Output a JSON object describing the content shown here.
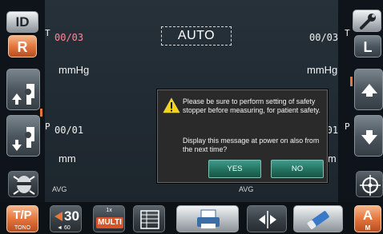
{
  "left_panel": {
    "id_label": "ID",
    "r_label": "R",
    "tono_main": "T/P",
    "tono_sub": "TONO"
  },
  "right_panel": {
    "l_label": "L",
    "a_label": "A",
    "m_label": "M"
  },
  "main": {
    "mode": "AUTO",
    "right_eye": {
      "t_label": "T",
      "t_value": "00/03",
      "t_unit": "mmHg",
      "p_label": "P",
      "p_value": "00/01",
      "p_unit": "mm",
      "avg_label": "AVG"
    },
    "left_eye": {
      "t_label": "T",
      "t_value": "00/03",
      "t_unit": "mmHg",
      "p_label": "P",
      "p_value": "00/01",
      "p_unit": "mm",
      "avg_label": "AVG"
    }
  },
  "dialog": {
    "message1": "Please be sure to perform setting of safety stopper before measuring, for patient safety.",
    "message2": "Display this message at power on also from the next time?",
    "yes_label": "YES",
    "no_label": "NO"
  },
  "bottom_bar": {
    "pressure_value": "30",
    "pressure_sub": "60",
    "multi_label": "MULTI",
    "multi_sub": "1x"
  },
  "colors": {
    "accent_orange": "#e4763e",
    "value_red": "#ff8a95",
    "dialog_button": "#23725f",
    "warning_yellow": "#f3d21a"
  }
}
